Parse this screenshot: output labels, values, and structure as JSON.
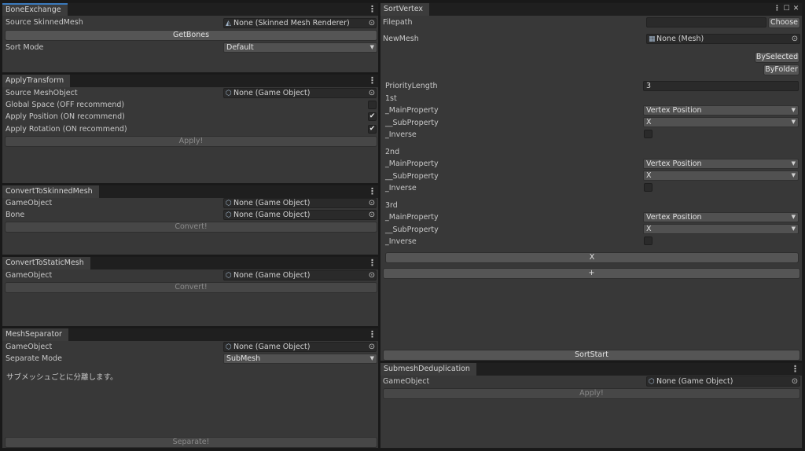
{
  "bone_exchange": {
    "tab": "BoneExchange",
    "source_label": "Source SkinnedMesh",
    "source_value": "None (Skinned Mesh Renderer)",
    "get_bones": "GetBones",
    "sort_mode_label": "Sort Mode",
    "sort_mode_value": "Default"
  },
  "apply_transform": {
    "tab": "ApplyTransform",
    "source_label": "Source MeshObject",
    "source_value": "None (Game Object)",
    "global_space_label": "Global Space (OFF recommend)",
    "global_space_checked": false,
    "apply_position_label": "Apply Position (ON recommend)",
    "apply_position_checked": true,
    "apply_rotation_label": "Apply Rotation (ON recommend)",
    "apply_rotation_checked": true,
    "apply_button": "Apply!"
  },
  "convert_skinned": {
    "tab": "ConvertToSkinnedMesh",
    "gameobject_label": "GameObject",
    "gameobject_value": "None (Game Object)",
    "bone_label": "Bone",
    "bone_value": "None (Game Object)",
    "convert_button": "Convert!"
  },
  "convert_static": {
    "tab": "ConvertToStaticMesh",
    "gameobject_label": "GameObject",
    "gameobject_value": "None (Game Object)",
    "convert_button": "Convert!"
  },
  "mesh_separator": {
    "tab": "MeshSeparator",
    "gameobject_label": "GameObject",
    "gameobject_value": "None (Game Object)",
    "mode_label": "Separate Mode",
    "mode_value": "SubMesh",
    "help": "サブメッシュごとに分離します。",
    "separate_button": "Separate!"
  },
  "sort_vertex": {
    "tab": "SortVertex",
    "filepath_label": "Filepath",
    "filepath_value": "",
    "choose_button": "Choose",
    "newmesh_label": "NewMesh",
    "newmesh_value": "None (Mesh)",
    "by_selected": "BySelected",
    "by_folder": "ByFolder",
    "priority_label": "PriorityLength",
    "priority_value": "3",
    "groups": [
      {
        "title": "1st",
        "main_label": "_MainProperty",
        "main_value": "Vertex Position",
        "sub_label": "__SubProperty",
        "sub_value": "X",
        "inverse_label": "_Inverse",
        "inverse_checked": false
      },
      {
        "title": "2nd",
        "main_label": "_MainProperty",
        "main_value": "Vertex Position",
        "sub_label": "__SubProperty",
        "sub_value": "X",
        "inverse_label": "_Inverse",
        "inverse_checked": false
      },
      {
        "title": "3rd",
        "main_label": "_MainProperty",
        "main_value": "Vertex Position",
        "sub_label": "__SubProperty",
        "sub_value": "X",
        "inverse_label": "_Inverse",
        "inverse_checked": false
      }
    ],
    "remove_button": "X",
    "add_button": "+",
    "sort_start": "SortStart"
  },
  "submesh_dedup": {
    "tab": "SubmeshDeduplication",
    "gameobject_label": "GameObject",
    "gameobject_value": "None (Game Object)",
    "apply_button": "Apply!"
  },
  "icons": {
    "menu": "⋮",
    "picker": "⊙",
    "dropdown_arrow": "▼",
    "check": "✔",
    "gameobject": "⬡",
    "mesh": "▦",
    "skinned": "◭",
    "maximize": "☐",
    "close": "✕"
  }
}
